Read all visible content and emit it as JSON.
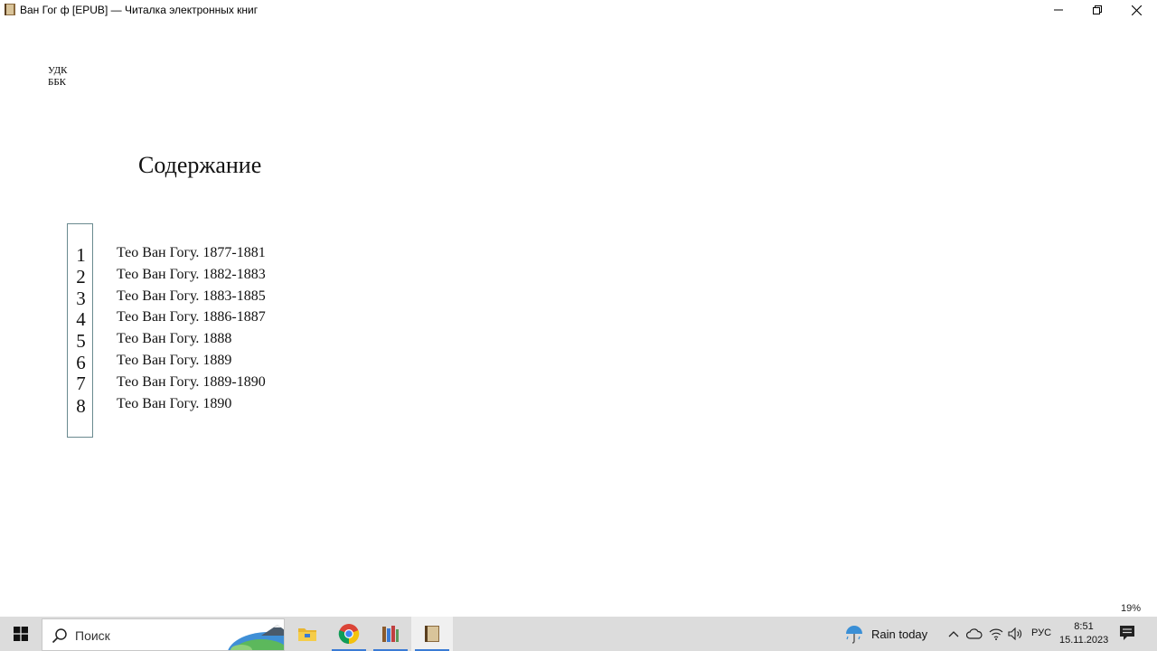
{
  "window": {
    "title": "Ван Гог ф [EPUB] — Читалка электронных книг",
    "app_icon": "book-reader-icon",
    "controls": [
      "minimize-icon",
      "restore-icon",
      "close-icon"
    ]
  },
  "page": {
    "udk": "УДК",
    "bbk": "ББК",
    "toc_heading": "Содержание",
    "toc": [
      {
        "num": "1",
        "title": "Тео Ван Гогу. 1877-1881"
      },
      {
        "num": "2",
        "title": "Тео Ван Гогу. 1882-1883"
      },
      {
        "num": "3",
        "title": "Тео Ван Гогу. 1883-1885"
      },
      {
        "num": "4",
        "title": "Тео Ван Гогу. 1886-1887"
      },
      {
        "num": "5",
        "title": "Тео Ван Гогу. 1888"
      },
      {
        "num": "6",
        "title": "Тео Ван Гогу. 1889"
      },
      {
        "num": "7",
        "title": "Тео Ван Гогу. 1889-1890"
      },
      {
        "num": "8",
        "title": "Тео Ван Гогу. 1890"
      }
    ],
    "progress": "19%"
  },
  "taskbar": {
    "search_placeholder": "Поиск",
    "apps": [
      "file-explorer-icon",
      "chrome-icon",
      "library-icon",
      "book-reader-icon"
    ],
    "weather": "Rain today",
    "weather_icon": "rain-umbrella-icon",
    "lang": "РУС",
    "time": "8:51",
    "date": "15.11.2023",
    "accent": "#3a7bd5"
  }
}
